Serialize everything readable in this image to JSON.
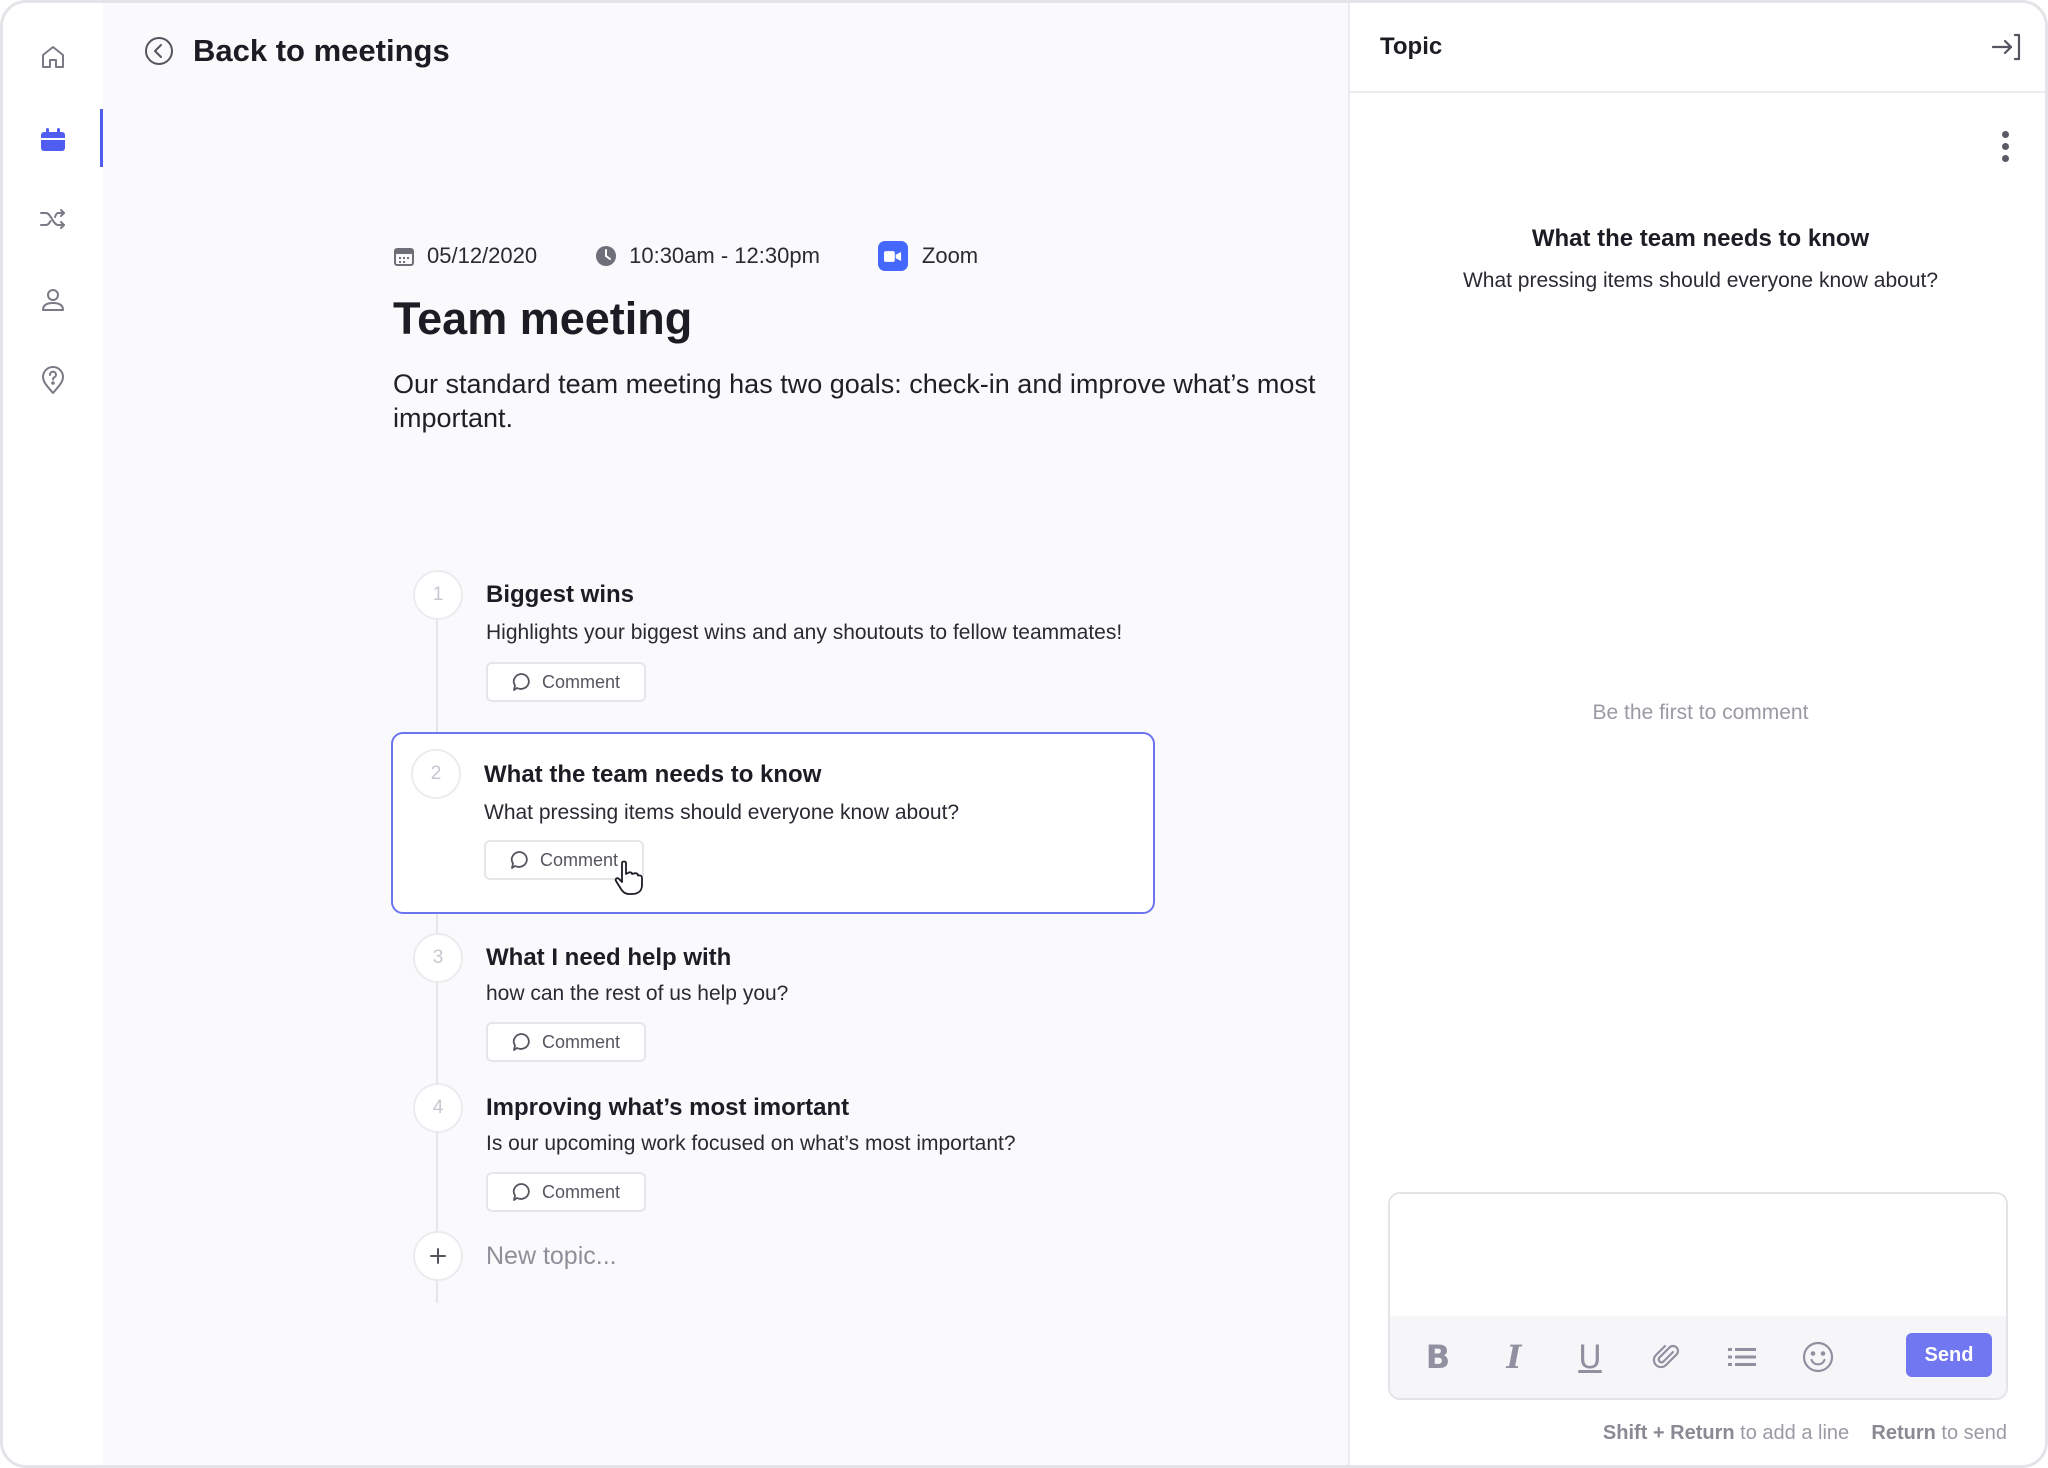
{
  "nav": {
    "items": [
      {
        "name": "home",
        "icon": "home-icon",
        "active": false
      },
      {
        "name": "meetings",
        "icon": "calendar-icon",
        "active": true
      },
      {
        "name": "shuffle",
        "icon": "shuffle-icon",
        "active": false
      },
      {
        "name": "profile",
        "icon": "user-icon",
        "active": false
      },
      {
        "name": "help",
        "icon": "help-location-icon",
        "active": false
      }
    ]
  },
  "header": {
    "back_label": "Back to meetings"
  },
  "meeting": {
    "date": "05/12/2020",
    "time": "10:30am - 12:30pm",
    "location": "Zoom",
    "title": "Team meeting",
    "description": "Our standard team meeting has two goals: check-in and improve what’s most important."
  },
  "topics": [
    {
      "number": "1",
      "title": "Biggest wins",
      "subtitle": "Highlights your biggest wins and any shoutouts to fellow teammates!",
      "comment_label": "Comment"
    },
    {
      "number": "2",
      "title": "What the team needs to know",
      "subtitle": "What pressing items should everyone know about?",
      "comment_label": "Comment"
    },
    {
      "number": "3",
      "title": "What I need help with",
      "subtitle": "how can the rest of us help you?",
      "comment_label": "Comment"
    },
    {
      "number": "4",
      "title": "Improving what’s most imortant",
      "subtitle": "Is our upcoming work focused on what’s most important?",
      "comment_label": "Comment"
    }
  ],
  "new_topic_placeholder": "New topic...",
  "panel": {
    "title": "Topic",
    "topic_title": "What the team needs to know",
    "topic_subtitle": "What pressing items should everyone know about?",
    "empty_state": "Be the first to  comment",
    "composer": {
      "tools": [
        "bold-icon",
        "italic-icon",
        "underline-icon",
        "attach-icon",
        "list-icon",
        "emoji-icon"
      ],
      "bold": "B",
      "italic": "I",
      "underline": "U",
      "send_label": "Send",
      "hint_key1": "Shift + Return",
      "hint_text1": "to add a line",
      "hint_key2": "Return",
      "hint_text2": "to send"
    }
  },
  "colors": {
    "accent": "#4f5df0",
    "send": "#7077f0",
    "zoom": "#4568ff"
  }
}
